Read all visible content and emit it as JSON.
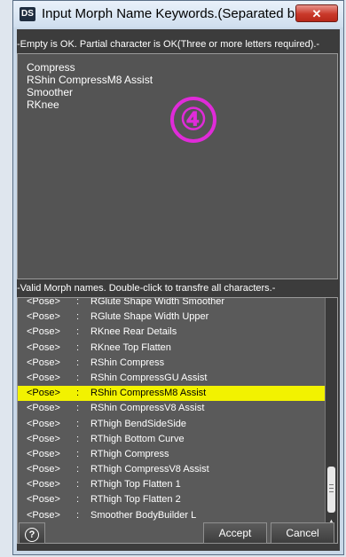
{
  "window": {
    "title": "Input Morph Name Keywords.(Separated b...",
    "app_icon": "DS",
    "close_glyph": "✕"
  },
  "keywords": {
    "hint": "-Empty is OK. Partial character is OK(Three or more letters required).-",
    "lines": [
      "Compress",
      "RShin CompressM8 Assist",
      "Smoother",
      "RKnee"
    ],
    "annotation": "④"
  },
  "morph_list": {
    "hint": "-Valid Morph names. Double-click to transfre all characters.-",
    "rows": [
      {
        "type": "<Pose>",
        "sep": ":",
        "name": "RGlute Shape Width Smoother"
      },
      {
        "type": "<Pose>",
        "sep": ":",
        "name": "RGlute Shape Width Upper"
      },
      {
        "type": "<Pose>",
        "sep": ":",
        "name": "RKnee Rear Details"
      },
      {
        "type": "<Pose>",
        "sep": ":",
        "name": "RKnee Top Flatten"
      },
      {
        "type": "<Pose>",
        "sep": ":",
        "name": "RShin Compress"
      },
      {
        "type": "<Pose>",
        "sep": ":",
        "name": "RShin CompressGU Assist"
      },
      {
        "type": "<Pose>",
        "sep": ":",
        "name": "RShin CompressM8 Assist",
        "selected": true
      },
      {
        "type": "<Pose>",
        "sep": ":",
        "name": "RShin CompressV8 Assist"
      },
      {
        "type": "<Pose>",
        "sep": ":",
        "name": "RThigh BendSideSide"
      },
      {
        "type": "<Pose>",
        "sep": ":",
        "name": "RThigh Bottom Curve"
      },
      {
        "type": "<Pose>",
        "sep": ":",
        "name": "RThigh Compress"
      },
      {
        "type": "<Pose>",
        "sep": ":",
        "name": "RThigh CompressV8 Assist"
      },
      {
        "type": "<Pose>",
        "sep": ":",
        "name": "RThigh Top Flatten 1"
      },
      {
        "type": "<Pose>",
        "sep": ":",
        "name": "RThigh Top Flatten 2"
      },
      {
        "type": "<Pose>",
        "sep": ":",
        "name": "Smoother BodyBuilder L"
      }
    ]
  },
  "buttons": {
    "help": "?",
    "accept": "Accept",
    "cancel": "Cancel"
  },
  "colors": {
    "selection": "#f2f200",
    "annotation": "#e02bd9",
    "panel": "#3c3c3c"
  }
}
